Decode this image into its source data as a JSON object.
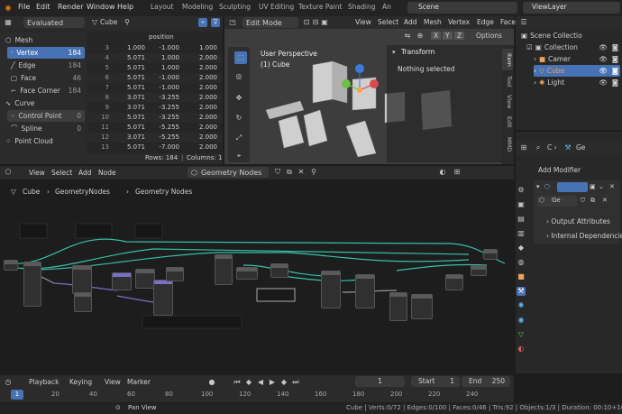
{
  "topbar": {
    "menus": [
      "File",
      "Edit",
      "Render",
      "Window",
      "Help"
    ],
    "workspaces": [
      "Layout",
      "Modeling",
      "Sculpting",
      "UV Editing",
      "Texture Paint",
      "Shading",
      "An"
    ],
    "scene": "Scene",
    "view_layer": "ViewLayer"
  },
  "spreadsheet": {
    "mode": "Evaluated",
    "object": "Cube",
    "tree": {
      "mesh": "Mesh",
      "items": [
        {
          "label": "Vertex",
          "count": "184"
        },
        {
          "label": "Edge",
          "count": "184"
        },
        {
          "label": "Face",
          "count": "46"
        },
        {
          "label": "Face Corner",
          "count": "184"
        }
      ],
      "curve": "Curve",
      "control_point": {
        "label": "Control Point",
        "count": "0"
      },
      "spline": {
        "label": "Spline",
        "count": "0"
      },
      "point_cloud": "Point Cloud"
    },
    "column_header": "position",
    "rows": [
      [
        "3",
        "1.000",
        "-1.000",
        "1.000"
      ],
      [
        "4",
        "5.071",
        "1.000",
        "2.000"
      ],
      [
        "5",
        "5.071",
        "1.000",
        "2.000"
      ],
      [
        "6",
        "5.071",
        "-1.000",
        "2.000"
      ],
      [
        "7",
        "5.071",
        "-1.000",
        "2.000"
      ],
      [
        "8",
        "3.071",
        "-3.255",
        "2.000"
      ],
      [
        "9",
        "3.071",
        "-3.255",
        "2.000"
      ],
      [
        "10",
        "5.071",
        "-3.255",
        "2.000"
      ],
      [
        "11",
        "5.071",
        "-5.255",
        "2.000"
      ],
      [
        "12",
        "3.071",
        "-5.255",
        "2.000"
      ],
      [
        "13",
        "5.071",
        "-7.000",
        "2.000"
      ]
    ],
    "status_rows": "Rows: 184",
    "status_cols": "Columns: 1"
  },
  "viewport": {
    "mode": "Edit Mode",
    "menus": [
      "View",
      "Select",
      "Add",
      "Mesh",
      "Vertex",
      "Edge",
      "Face"
    ],
    "xyz": [
      "X",
      "Y",
      "Z"
    ],
    "options": "Options",
    "perspective": "User Perspective",
    "object": "(1) Cube",
    "transform_title": "Transform",
    "transform_msg": "Nothing selected",
    "tabs": [
      "Item",
      "Tool",
      "View",
      "Edit",
      "MMD"
    ]
  },
  "outliner": {
    "items": [
      {
        "label": "Scene Collectio"
      },
      {
        "label": "Collection"
      },
      {
        "label": "Camer"
      },
      {
        "label": "Cube"
      },
      {
        "label": "Light"
      }
    ]
  },
  "properties": {
    "breadcrumb": "Ge",
    "add_modifier": "Add Modifier",
    "modifier_name": "",
    "node_group": "Ge",
    "output_attributes": "Output Attributes",
    "internal_deps": "Internal Dependencie"
  },
  "node_editor": {
    "menus": [
      "View",
      "Select",
      "Add",
      "Node"
    ],
    "tree_name": "Geometry Nodes",
    "breadcrumb": [
      "Cube",
      "GeometryNodes",
      "Geometry Nodes"
    ]
  },
  "timeline": {
    "menus": [
      "Playback",
      "Keying",
      "View",
      "Marker"
    ],
    "current_frame": "1",
    "start_label": "Start",
    "start": "1",
    "end_label": "End",
    "end": "250",
    "ticks": [
      "20",
      "40",
      "60",
      "80",
      "100",
      "120",
      "140",
      "160",
      "180",
      "200",
      "220",
      "240"
    ],
    "frame_badge": "1"
  },
  "statusbar": {
    "hint": "Pan View",
    "stats": "Cube | Verts:0/72 | Edges:0/100 | Faces:0/46 | Tris:92 | Objects:1/3 | Duration: 00:10+10 (Fram"
  },
  "colors": {
    "accent": "#4772b3",
    "edge_teal": "#36c0a8",
    "node_purple": "#7a6fc9"
  }
}
